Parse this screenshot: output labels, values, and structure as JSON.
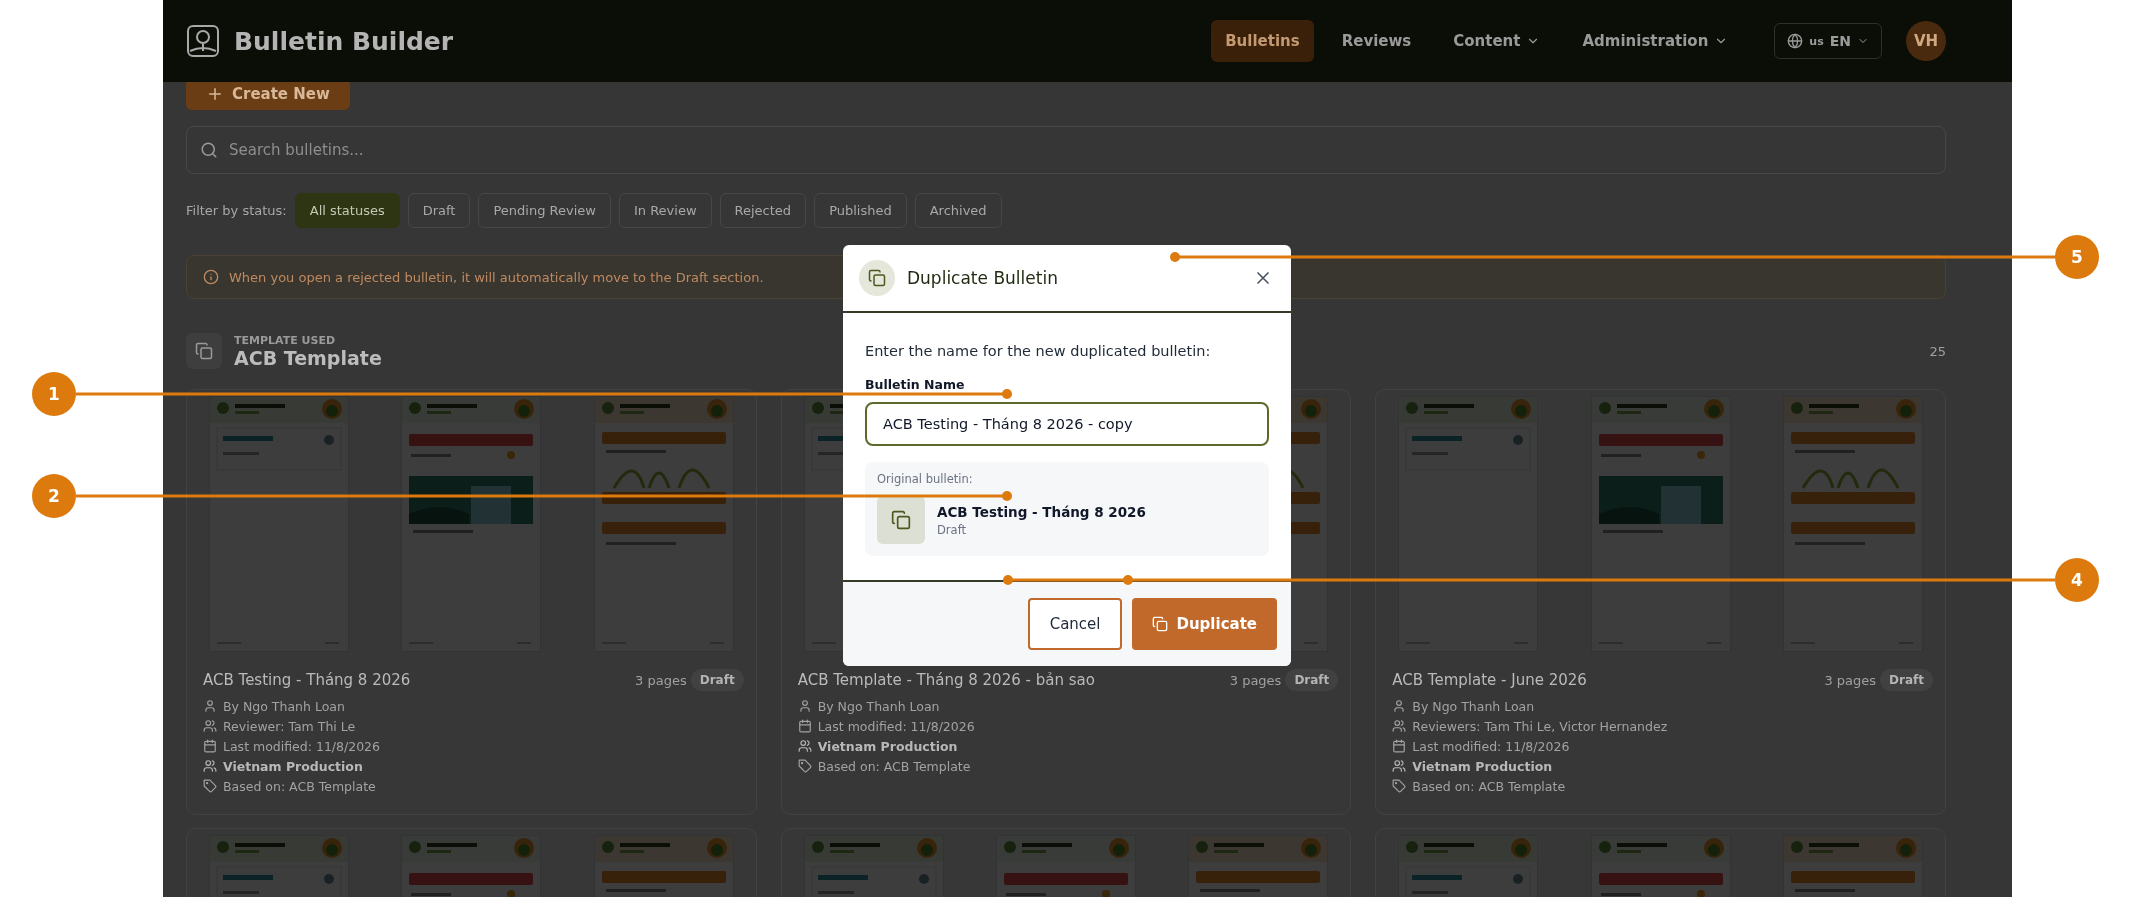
{
  "header": {
    "app_name": "Bulletin Builder",
    "nav": [
      {
        "label": "Bulletins",
        "selected": true,
        "dropdown": false
      },
      {
        "label": "Reviews",
        "selected": false,
        "dropdown": false
      },
      {
        "label": "Content",
        "selected": false,
        "dropdown": true
      },
      {
        "label": "Administration",
        "selected": false,
        "dropdown": true
      }
    ],
    "language": {
      "region": "us",
      "code": "EN"
    },
    "avatar": "VH"
  },
  "toolbar": {
    "create_button": "Create New",
    "search": {
      "placeholder": "Search bulletins..."
    }
  },
  "filter": {
    "label": "Filter by status:",
    "options": [
      {
        "label": "All statuses",
        "selected": true
      },
      {
        "label": "Draft",
        "selected": false
      },
      {
        "label": "Pending Review",
        "selected": false
      },
      {
        "label": "In Review",
        "selected": false
      },
      {
        "label": "Rejected",
        "selected": false
      },
      {
        "label": "Published",
        "selected": false
      },
      {
        "label": "Archived",
        "selected": false
      }
    ]
  },
  "notice": "When you open a rejected bulletin, it will automatically move to the Draft section.",
  "template_group": {
    "caption": "TEMPLATE USED",
    "name": "ACB Template",
    "count": "25",
    "cards": [
      {
        "pages": [
          {
            "kind": "forecast"
          },
          {
            "kind": "weather"
          },
          {
            "kind": "crop"
          }
        ],
        "title": "ACB Testing - Tháng 8 2026",
        "page_count": "3 pages",
        "status": "Draft",
        "meta": [
          {
            "kind": "author",
            "text": "By Ngo Thanh Loan"
          },
          {
            "kind": "reviewer",
            "text": "Reviewer: Tam Thi Le"
          },
          {
            "kind": "modified",
            "text": "Last modified: 11/8/2026"
          },
          {
            "kind": "team",
            "text": "Vietnam Production"
          },
          {
            "kind": "template",
            "text": "Based on: ACB Template"
          }
        ]
      },
      {
        "pages": [
          {
            "kind": "forecast"
          },
          {
            "kind": "crop"
          }
        ],
        "title": "ACB Template - Tháng 8 2026 - bản sao",
        "page_count": "3 pages",
        "status": "Draft",
        "meta": [
          {
            "kind": "author",
            "text": "By Ngo Thanh Loan"
          },
          {
            "kind": "modified",
            "text": "Last modified: 11/8/2026"
          },
          {
            "kind": "team",
            "text": "Vietnam Production"
          },
          {
            "kind": "template",
            "text": "Based on: ACB Template"
          }
        ]
      },
      {
        "pages": [
          {
            "kind": "forecast"
          },
          {
            "kind": "weather"
          },
          {
            "kind": "crop"
          }
        ],
        "title": "ACB Template - June 2026",
        "page_count": "3 pages",
        "status": "Draft",
        "meta": [
          {
            "kind": "author",
            "text": "By Ngo Thanh Loan"
          },
          {
            "kind": "reviewer",
            "text": "Reviewers: Tam Thi Le, Victor Hernandez"
          },
          {
            "kind": "modified",
            "text": "Last modified: 11/8/2026"
          },
          {
            "kind": "team",
            "text": "Vietnam Production"
          },
          {
            "kind": "template",
            "text": "Based on: ACB Template"
          }
        ]
      },
      {
        "pages": [
          {
            "kind": "forecast"
          },
          {
            "kind": "weather"
          },
          {
            "kind": "crop"
          }
        ]
      },
      {
        "pages": [
          {
            "kind": "forecast"
          },
          {
            "kind": "weather"
          },
          {
            "kind": "crop"
          }
        ]
      },
      {
        "pages": [
          {
            "kind": "forecast"
          },
          {
            "kind": "weather"
          },
          {
            "kind": "crop"
          }
        ]
      }
    ]
  },
  "dialog": {
    "title": "Duplicate Bulletin",
    "prompt": "Enter the name for the new duplicated bulletin:",
    "field": {
      "label": "Bulletin Name",
      "value": "ACB Testing - Tháng 8 2026 - copy"
    },
    "original": {
      "caption": "Original bulletin:",
      "name": "ACB Testing - Tháng 8 2026",
      "status": "Draft"
    },
    "buttons": [
      {
        "label": "Cancel",
        "kind": "secondary"
      },
      {
        "label": "Duplicate",
        "kind": "primary"
      }
    ]
  },
  "callouts": [
    {
      "number": "1"
    },
    {
      "number": "2"
    },
    {
      "number": "4"
    },
    {
      "number": "5"
    }
  ]
}
